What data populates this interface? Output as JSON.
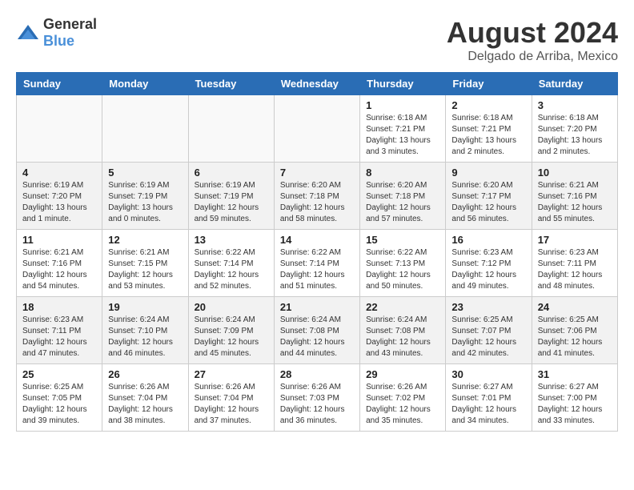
{
  "header": {
    "logo_general": "General",
    "logo_blue": "Blue",
    "month": "August 2024",
    "location": "Delgado de Arriba, Mexico"
  },
  "weekdays": [
    "Sunday",
    "Monday",
    "Tuesday",
    "Wednesday",
    "Thursday",
    "Friday",
    "Saturday"
  ],
  "weeks": [
    [
      {
        "day": "",
        "info": ""
      },
      {
        "day": "",
        "info": ""
      },
      {
        "day": "",
        "info": ""
      },
      {
        "day": "",
        "info": ""
      },
      {
        "day": "1",
        "info": "Sunrise: 6:18 AM\nSunset: 7:21 PM\nDaylight: 13 hours\nand 3 minutes."
      },
      {
        "day": "2",
        "info": "Sunrise: 6:18 AM\nSunset: 7:21 PM\nDaylight: 13 hours\nand 2 minutes."
      },
      {
        "day": "3",
        "info": "Sunrise: 6:18 AM\nSunset: 7:20 PM\nDaylight: 13 hours\nand 2 minutes."
      }
    ],
    [
      {
        "day": "4",
        "info": "Sunrise: 6:19 AM\nSunset: 7:20 PM\nDaylight: 13 hours\nand 1 minute."
      },
      {
        "day": "5",
        "info": "Sunrise: 6:19 AM\nSunset: 7:19 PM\nDaylight: 13 hours\nand 0 minutes."
      },
      {
        "day": "6",
        "info": "Sunrise: 6:19 AM\nSunset: 7:19 PM\nDaylight: 12 hours\nand 59 minutes."
      },
      {
        "day": "7",
        "info": "Sunrise: 6:20 AM\nSunset: 7:18 PM\nDaylight: 12 hours\nand 58 minutes."
      },
      {
        "day": "8",
        "info": "Sunrise: 6:20 AM\nSunset: 7:18 PM\nDaylight: 12 hours\nand 57 minutes."
      },
      {
        "day": "9",
        "info": "Sunrise: 6:20 AM\nSunset: 7:17 PM\nDaylight: 12 hours\nand 56 minutes."
      },
      {
        "day": "10",
        "info": "Sunrise: 6:21 AM\nSunset: 7:16 PM\nDaylight: 12 hours\nand 55 minutes."
      }
    ],
    [
      {
        "day": "11",
        "info": "Sunrise: 6:21 AM\nSunset: 7:16 PM\nDaylight: 12 hours\nand 54 minutes."
      },
      {
        "day": "12",
        "info": "Sunrise: 6:21 AM\nSunset: 7:15 PM\nDaylight: 12 hours\nand 53 minutes."
      },
      {
        "day": "13",
        "info": "Sunrise: 6:22 AM\nSunset: 7:14 PM\nDaylight: 12 hours\nand 52 minutes."
      },
      {
        "day": "14",
        "info": "Sunrise: 6:22 AM\nSunset: 7:14 PM\nDaylight: 12 hours\nand 51 minutes."
      },
      {
        "day": "15",
        "info": "Sunrise: 6:22 AM\nSunset: 7:13 PM\nDaylight: 12 hours\nand 50 minutes."
      },
      {
        "day": "16",
        "info": "Sunrise: 6:23 AM\nSunset: 7:12 PM\nDaylight: 12 hours\nand 49 minutes."
      },
      {
        "day": "17",
        "info": "Sunrise: 6:23 AM\nSunset: 7:11 PM\nDaylight: 12 hours\nand 48 minutes."
      }
    ],
    [
      {
        "day": "18",
        "info": "Sunrise: 6:23 AM\nSunset: 7:11 PM\nDaylight: 12 hours\nand 47 minutes."
      },
      {
        "day": "19",
        "info": "Sunrise: 6:24 AM\nSunset: 7:10 PM\nDaylight: 12 hours\nand 46 minutes."
      },
      {
        "day": "20",
        "info": "Sunrise: 6:24 AM\nSunset: 7:09 PM\nDaylight: 12 hours\nand 45 minutes."
      },
      {
        "day": "21",
        "info": "Sunrise: 6:24 AM\nSunset: 7:08 PM\nDaylight: 12 hours\nand 44 minutes."
      },
      {
        "day": "22",
        "info": "Sunrise: 6:24 AM\nSunset: 7:08 PM\nDaylight: 12 hours\nand 43 minutes."
      },
      {
        "day": "23",
        "info": "Sunrise: 6:25 AM\nSunset: 7:07 PM\nDaylight: 12 hours\nand 42 minutes."
      },
      {
        "day": "24",
        "info": "Sunrise: 6:25 AM\nSunset: 7:06 PM\nDaylight: 12 hours\nand 41 minutes."
      }
    ],
    [
      {
        "day": "25",
        "info": "Sunrise: 6:25 AM\nSunset: 7:05 PM\nDaylight: 12 hours\nand 39 minutes."
      },
      {
        "day": "26",
        "info": "Sunrise: 6:26 AM\nSunset: 7:04 PM\nDaylight: 12 hours\nand 38 minutes."
      },
      {
        "day": "27",
        "info": "Sunrise: 6:26 AM\nSunset: 7:04 PM\nDaylight: 12 hours\nand 37 minutes."
      },
      {
        "day": "28",
        "info": "Sunrise: 6:26 AM\nSunset: 7:03 PM\nDaylight: 12 hours\nand 36 minutes."
      },
      {
        "day": "29",
        "info": "Sunrise: 6:26 AM\nSunset: 7:02 PM\nDaylight: 12 hours\nand 35 minutes."
      },
      {
        "day": "30",
        "info": "Sunrise: 6:27 AM\nSunset: 7:01 PM\nDaylight: 12 hours\nand 34 minutes."
      },
      {
        "day": "31",
        "info": "Sunrise: 6:27 AM\nSunset: 7:00 PM\nDaylight: 12 hours\nand 33 minutes."
      }
    ]
  ]
}
